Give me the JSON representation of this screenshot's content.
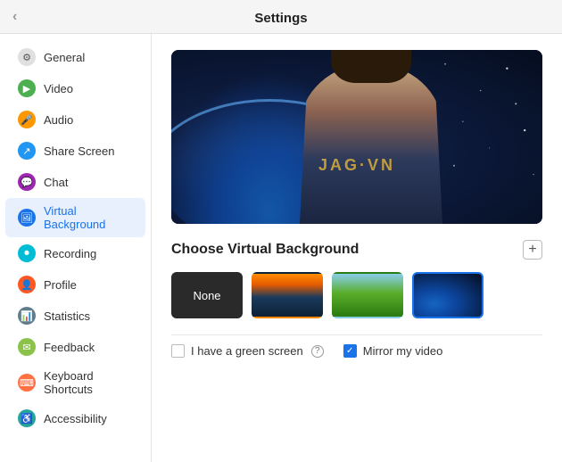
{
  "titleBar": {
    "title": "Settings",
    "closeLabel": "×"
  },
  "sidebar": {
    "items": [
      {
        "id": "general",
        "label": "General",
        "iconClass": "icon-general",
        "iconChar": "⚙"
      },
      {
        "id": "video",
        "label": "Video",
        "iconClass": "icon-video",
        "iconChar": "▶"
      },
      {
        "id": "audio",
        "label": "Audio",
        "iconClass": "icon-audio",
        "iconChar": "🎙"
      },
      {
        "id": "share-screen",
        "label": "Share Screen",
        "iconClass": "icon-share",
        "iconChar": "⬜"
      },
      {
        "id": "chat",
        "label": "Chat",
        "iconClass": "icon-chat",
        "iconChar": "💬"
      },
      {
        "id": "virtual-background",
        "label": "Virtual Background",
        "iconClass": "icon-vbg",
        "iconChar": "🖼",
        "active": true
      },
      {
        "id": "recording",
        "label": "Recording",
        "iconClass": "icon-recording",
        "iconChar": "⏺"
      },
      {
        "id": "profile",
        "label": "Profile",
        "iconClass": "icon-profile",
        "iconChar": "👤"
      },
      {
        "id": "statistics",
        "label": "Statistics",
        "iconClass": "icon-stats",
        "iconChar": "📊"
      },
      {
        "id": "feedback",
        "label": "Feedback",
        "iconClass": "icon-feedback",
        "iconChar": "💬"
      },
      {
        "id": "keyboard-shortcuts",
        "label": "Keyboard Shortcuts",
        "iconClass": "icon-keyboard",
        "iconChar": "⌨"
      },
      {
        "id": "accessibility",
        "label": "Accessibility",
        "iconClass": "icon-access",
        "iconChar": "♿"
      }
    ]
  },
  "content": {
    "sectionTitle": "Choose Virtual Background",
    "addButtonLabel": "+",
    "backgrounds": [
      {
        "id": "none",
        "label": "None",
        "type": "none",
        "selected": false
      },
      {
        "id": "bridge",
        "label": "Golden Gate Bridge",
        "type": "bridge",
        "selected": false
      },
      {
        "id": "grass",
        "label": "Grass",
        "type": "grass",
        "selected": false
      },
      {
        "id": "space",
        "label": "Space",
        "type": "space",
        "selected": true
      }
    ],
    "greenScreen": {
      "label": "I have a green screen",
      "checked": false
    },
    "mirrorVideo": {
      "label": "Mirror my video",
      "checked": true
    },
    "watermark": "JAG·VN"
  }
}
